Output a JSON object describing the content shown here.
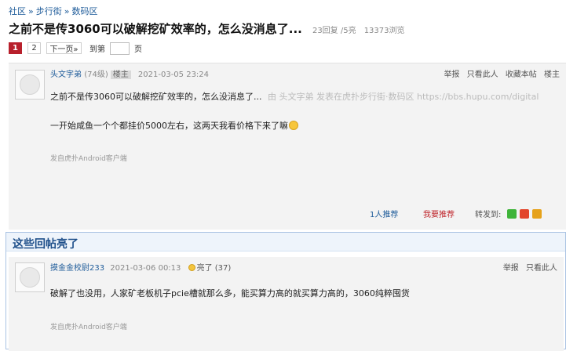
{
  "breadcrumb": {
    "items": [
      "社区",
      "步行街",
      "数码区"
    ],
    "sep": "»"
  },
  "thread": {
    "title": "之前不是传3060可以破解挖矿效率的，怎么没消息了...",
    "replies": "23回复 /5亮",
    "views": "13373浏览"
  },
  "pager": {
    "current": "1",
    "page2": "2",
    "next": "下一页»",
    "goto_label": "到第",
    "page_label": "页"
  },
  "post1": {
    "author": "头文字弟",
    "level": "(74级)",
    "badge": "楼主",
    "time": "2021-03-05 23:24",
    "actions": [
      "举报",
      "只看此人",
      "收藏本帖",
      "楼主"
    ],
    "line1": "之前不是传3060可以破解挖矿效率的，怎么没消息了...",
    "line1_src": "由 头文字弟 发表在虎扑步行街·数码区 https://bbs.hupu.com/digital",
    "line2": "一开始咸鱼一个个都挂价5000左右，这两天我看价格下来了嘛",
    "device": "发自虎扑Android客户端",
    "recommend": "1人推荐",
    "want_recommend": "我要推荐",
    "share_label": "转发到:"
  },
  "hot": {
    "heading": "这些回帖亮了",
    "post": {
      "author": "摸金金校尉233",
      "time": "2021-03-06 00:13",
      "light": "亮了 (37)",
      "actions": [
        "举报",
        "只看此人"
      ],
      "text": "破解了也没用，人家矿老板机子pcie槽就那么多，能买算力高的就买算力高的，3060纯粹囤货",
      "device": "发自虎扑Android客户端"
    }
  }
}
